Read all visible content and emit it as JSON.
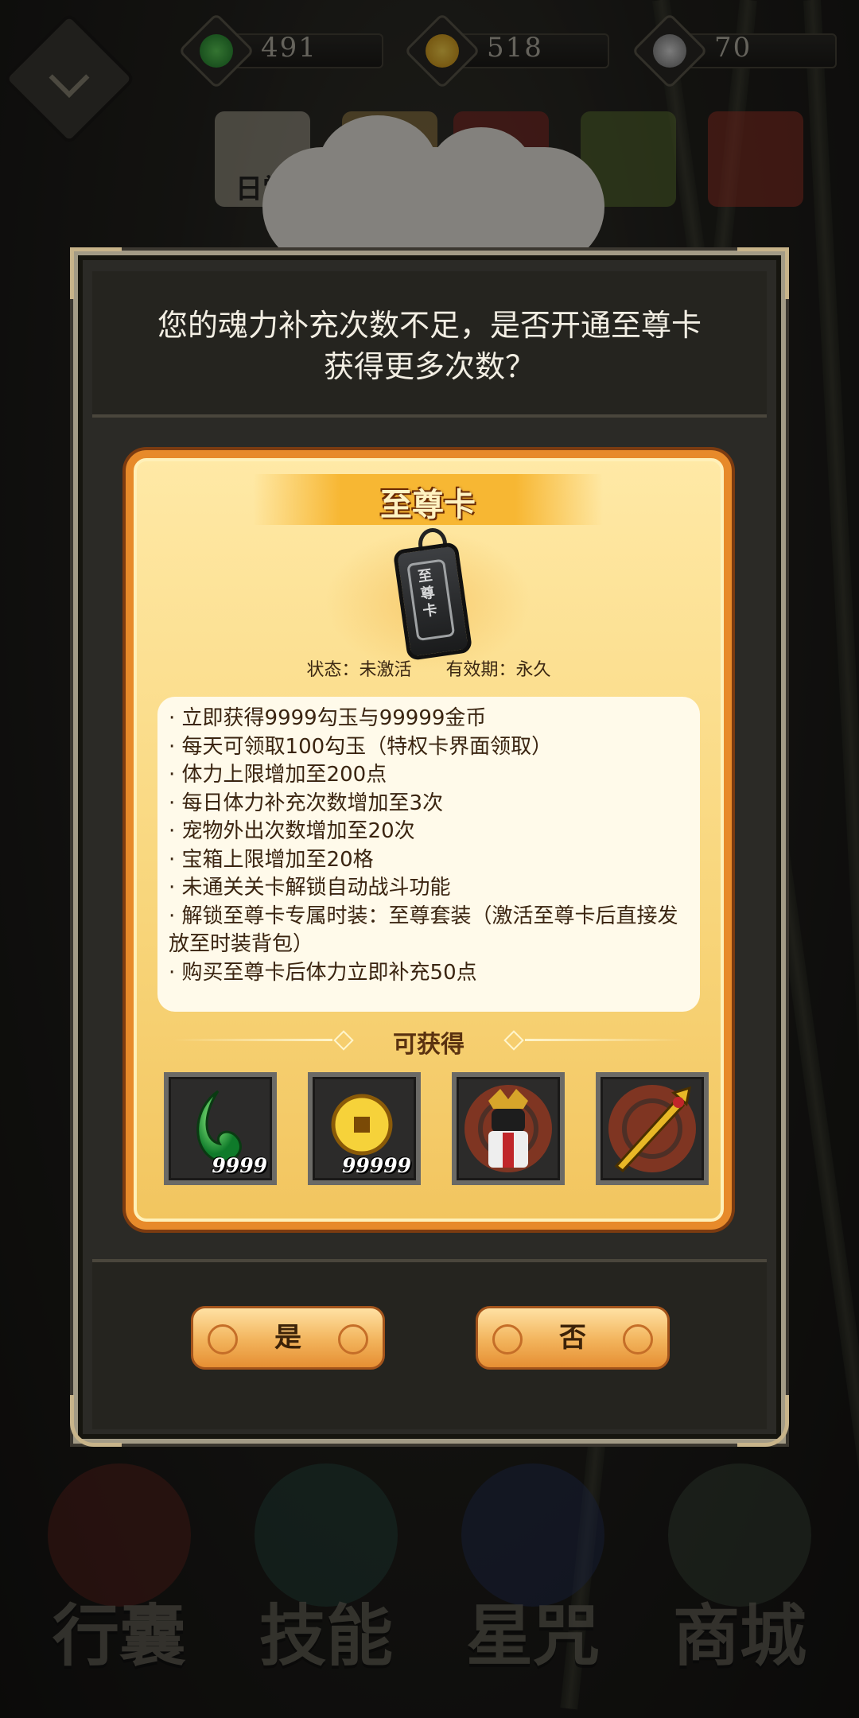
{
  "currencies": [
    {
      "icon": "green-magatama-icon",
      "value": "491"
    },
    {
      "icon": "gold-coin-icon",
      "value": "518"
    },
    {
      "icon": "spirit-swirl-icon",
      "value": "70"
    }
  ],
  "shop_tabs": [
    "日常"
  ],
  "dialog": {
    "message": "您的魂力补充次数不足，是否开通至尊卡\n获得更多次数？",
    "card": {
      "name": "至尊卡",
      "tag_text": "至尊卡",
      "status_label": "状态：未激活",
      "validity_label": "有效期：永久",
      "benefits": [
        "立即获得9999勾玉与99999金币",
        "每天可领取100勾玉（特权卡界面领取）",
        "体力上限增加至200点",
        "每日体力补充次数增加至3次",
        "宠物外出次数增加至20次",
        "宝箱上限增加至20格",
        "未通关关卡解锁自动战斗功能",
        "解锁至尊卡专属时装：至尊套装（激活至尊卡后直接发放至时装背包）",
        "购买至尊卡后体力立即补充50点"
      ],
      "obtain_title": "可获得",
      "rewards": [
        {
          "icon": "magatama-icon",
          "qty": "9999"
        },
        {
          "icon": "gold-coin-icon",
          "qty": "99999"
        },
        {
          "icon": "armor-costume-icon",
          "qty": ""
        },
        {
          "icon": "golden-weapon-icon",
          "qty": ""
        }
      ]
    },
    "yes_label": "是",
    "no_label": "否"
  },
  "bottom_nav": [
    "行囊",
    "技能",
    "星咒",
    "商城"
  ]
}
